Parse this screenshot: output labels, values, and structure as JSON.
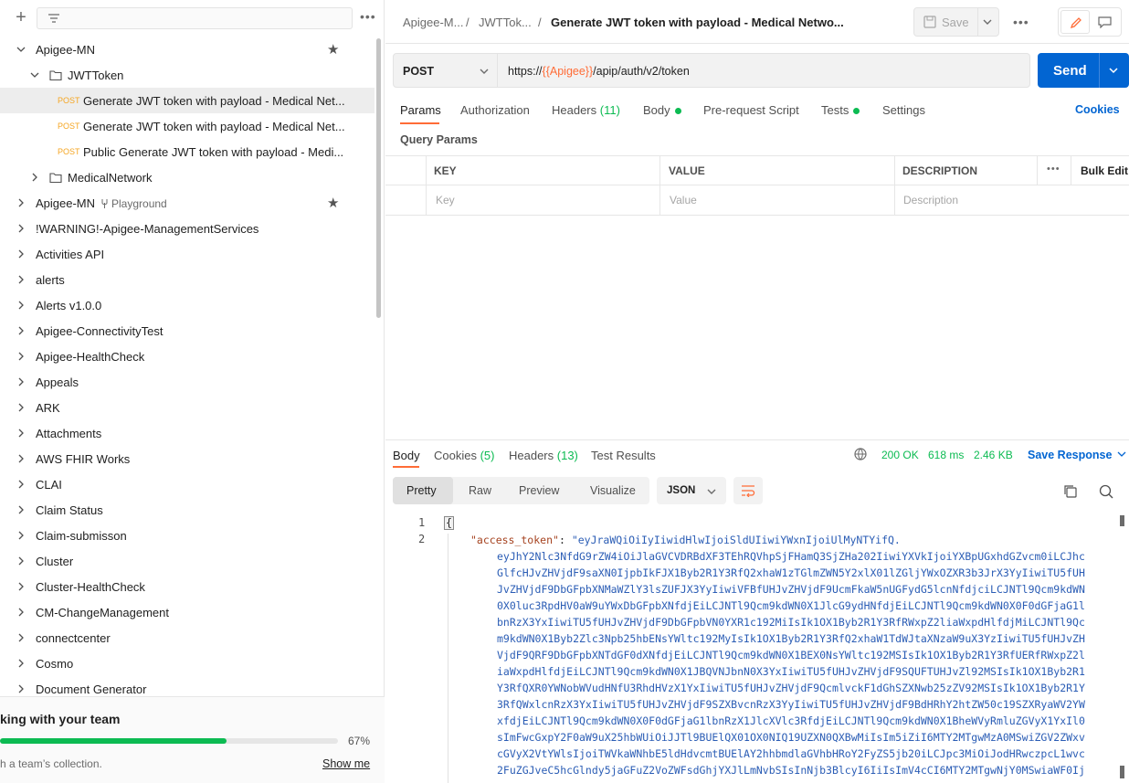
{
  "sidebar": {
    "collections": [
      {
        "label": "Apigee-MN",
        "depth": 0,
        "expanded": true,
        "starred": true
      },
      {
        "label": "JWTToken",
        "depth": 1,
        "expanded": true,
        "folder": true
      },
      {
        "label": "Generate JWT token with payload - Medical Net...",
        "depth": 2,
        "method": "POST",
        "selected": true
      },
      {
        "label": "Generate JWT token with payload - Medical Net...",
        "depth": 2,
        "method": "POST"
      },
      {
        "label": "Public Generate JWT token with payload - Medi...",
        "depth": 2,
        "method": "POST"
      },
      {
        "label": "MedicalNetwork",
        "depth": 1,
        "folder": true
      },
      {
        "label": "Apigee-MN",
        "depth": 0,
        "badge": "Playground",
        "starred": true
      },
      {
        "label": "!WARNING!-Apigee-ManagementServices",
        "depth": 0
      },
      {
        "label": "Activities API",
        "depth": 0
      },
      {
        "label": "alerts",
        "depth": 0
      },
      {
        "label": "Alerts v1.0.0",
        "depth": 0
      },
      {
        "label": "Apigee-ConnectivityTest",
        "depth": 0
      },
      {
        "label": "Apigee-HealthCheck",
        "depth": 0
      },
      {
        "label": "Appeals",
        "depth": 0
      },
      {
        "label": "ARK",
        "depth": 0
      },
      {
        "label": "Attachments",
        "depth": 0
      },
      {
        "label": "AWS FHIR Works",
        "depth": 0
      },
      {
        "label": "CLAI",
        "depth": 0
      },
      {
        "label": "Claim Status",
        "depth": 0
      },
      {
        "label": "Claim-submisson",
        "depth": 0
      },
      {
        "label": "Cluster",
        "depth": 0
      },
      {
        "label": "Cluster-HealthCheck",
        "depth": 0
      },
      {
        "label": "CM-ChangeManagement",
        "depth": 0
      },
      {
        "label": "connectcenter",
        "depth": 0
      },
      {
        "label": "Cosmo",
        "depth": 0
      },
      {
        "label": "Document Generator",
        "depth": 0
      }
    ],
    "footer": {
      "title": "king with your team",
      "progress_percent": 67,
      "progress_text": "67%",
      "subtitle": "h a team’s collection.",
      "show_me": "Show me"
    }
  },
  "header": {
    "crumb1": "Apigee-M...",
    "sep": "/",
    "crumb2": "JWTTok...",
    "title": "Generate JWT token with payload - Medical Netwo...",
    "save_label": "Save"
  },
  "request": {
    "method": "POST",
    "url_prefix": "https://",
    "url_var": "{{Apigee}}",
    "url_suffix": "/apip/auth/v2/token",
    "send_label": "Send",
    "tabs": {
      "params": "Params",
      "authorization": "Authorization",
      "headers": "Headers",
      "headers_count": "(11)",
      "body": "Body",
      "prerequest": "Pre-request Script",
      "tests": "Tests",
      "settings": "Settings"
    },
    "cookies": "Cookies",
    "query_params_title": "Query Params",
    "table": {
      "col_key": "KEY",
      "col_value": "VALUE",
      "col_description": "DESCRIPTION",
      "bulk_edit": "Bulk Edit",
      "ph_key": "Key",
      "ph_value": "Value",
      "ph_description": "Description"
    }
  },
  "response": {
    "tabs": {
      "body": "Body",
      "cookies": "Cookies",
      "cookies_count": "(5)",
      "headers": "Headers",
      "headers_count": "(13)",
      "test_results": "Test Results"
    },
    "status": "200 OK",
    "time": "618 ms",
    "size": "2.46 KB",
    "save_response": "Save Response",
    "view_modes": {
      "pretty": "Pretty",
      "raw": "Raw",
      "preview": "Preview",
      "visualize": "Visualize"
    },
    "format": "JSON",
    "line1": "1",
    "line2": "2",
    "brace": "{",
    "json_key": "\"access_token\"",
    "colon": ":",
    "token_first": "\"eyJraWQiOiIyIiwidHlwIjoiSldUIiwiYWxnIjoiUlMyNTYifQ.",
    "token_lines": [
      "eyJhY2Nlc3NfdG9rZW4iOiJlaGVCVDRBdXF3TEhRQVhpSjFHamQ3SjZHa202IiwiYXVkIjoiYXBpUGxhdGZvcm0iLCJhc",
      "GlfcHJvZHVjdF9saXN0IjpbIkFJX1Byb2R1Y3RfQ2xhaW1zTGlmZWN5Y2xlX01lZGljYWxOZXR3b3JrX3YyIiwiTU5fUH",
      "JvZHVjdF9DbGFpbXNMaWZlY3lsZUFJX3YyIiwiVFBfUHJvZHVjdF9UcmFkaW5nUGFydG5lcnNfdjciLCJNTl9Qcm9kdWN",
      "0X0luc3RpdHV0aW9uYWxDbGFpbXNfdjEiLCJNTl9Qcm9kdWN0X1JlcG9ydHNfdjEiLCJNTl9Qcm9kdWN0X0F0dGFjaG1l",
      "bnRzX3YxIiwiTU5fUHJvZHVjdF9DbGFpbVN0YXR1c192MiIsIk1OX1Byb2R1Y3RfRWxpZ2liaWxpdHlfdjMiLCJNTl9Qc",
      "m9kdWN0X1Byb2Zlc3Npb25hbENsYWltc192MyIsIk1OX1Byb2R1Y3RfQ2xhaW1TdWJtaXNzaW9uX3YzIiwiTU5fUHJvZH",
      "VjdF9QRF9DbGFpbXNTdGF0dXNfdjEiLCJNTl9Qcm9kdWN0X1BEX0NsYWltc192MSIsIk1OX1Byb2R1Y3RfUERfRWxpZ2l",
      "iaWxpdHlfdjEiLCJNTl9Qcm9kdWN0X1JBQVNJbnN0X3YxIiwiTU5fUHJvZHVjdF9SQUFTUHJvZl92MSIsIk1OX1Byb2R1",
      "Y3RfQXR0YWNobWVudHNfU3RhdHVzX1YxIiwiTU5fUHJvZHVjdF9QcmlvckF1dGhSZXNwb25zZV92MSIsIk1OX1Byb2R1Y",
      "3RfQWxlcnRzX3YxIiwiTU5fUHJvZHVjdF9SZXBvcnRzX3YyIiwiTU5fUHJvZHVjdF9BdHRhY2htZW50c19SZXRyaWV2YW",
      "xfdjEiLCJNTl9Qcm9kdWN0X0F0dGFjaG1lbnRzX1JlcXVlc3RfdjEiLCJNTl9Qcm9kdWN0X1BheWVyRmluZGVyX1YxIl0",
      "sImFwcGxpY2F0aW9uX25hbWUiOiJJTl9BUElQX01OX0NIQ19UZXN0QXBwMiIsIm5iZiI6MTY2MTgwMzA0MSwiZGV2ZWxv",
      "cGVyX2VtYWlsIjoiTWVkaWNhbE5ldHdvcmtBUElAY2hhbmdlaGVhbHRoY2FyZS5jb20iLCJpc3MiOiJodHRwczpcL1wvc",
      "2FuZGJveC5hcGlndy5jaGFuZ2VoZWFsdGhjYXJlLmNvbSIsInNjb3BlcyI6IiIsImV4cCI6MTY2MTgwNjY0MSwiaWF0Ij"
    ]
  },
  "colors": {
    "accent": "#ff6c37",
    "send": "#0265d2",
    "success": "#0cbb52",
    "link": "#0265d2"
  }
}
